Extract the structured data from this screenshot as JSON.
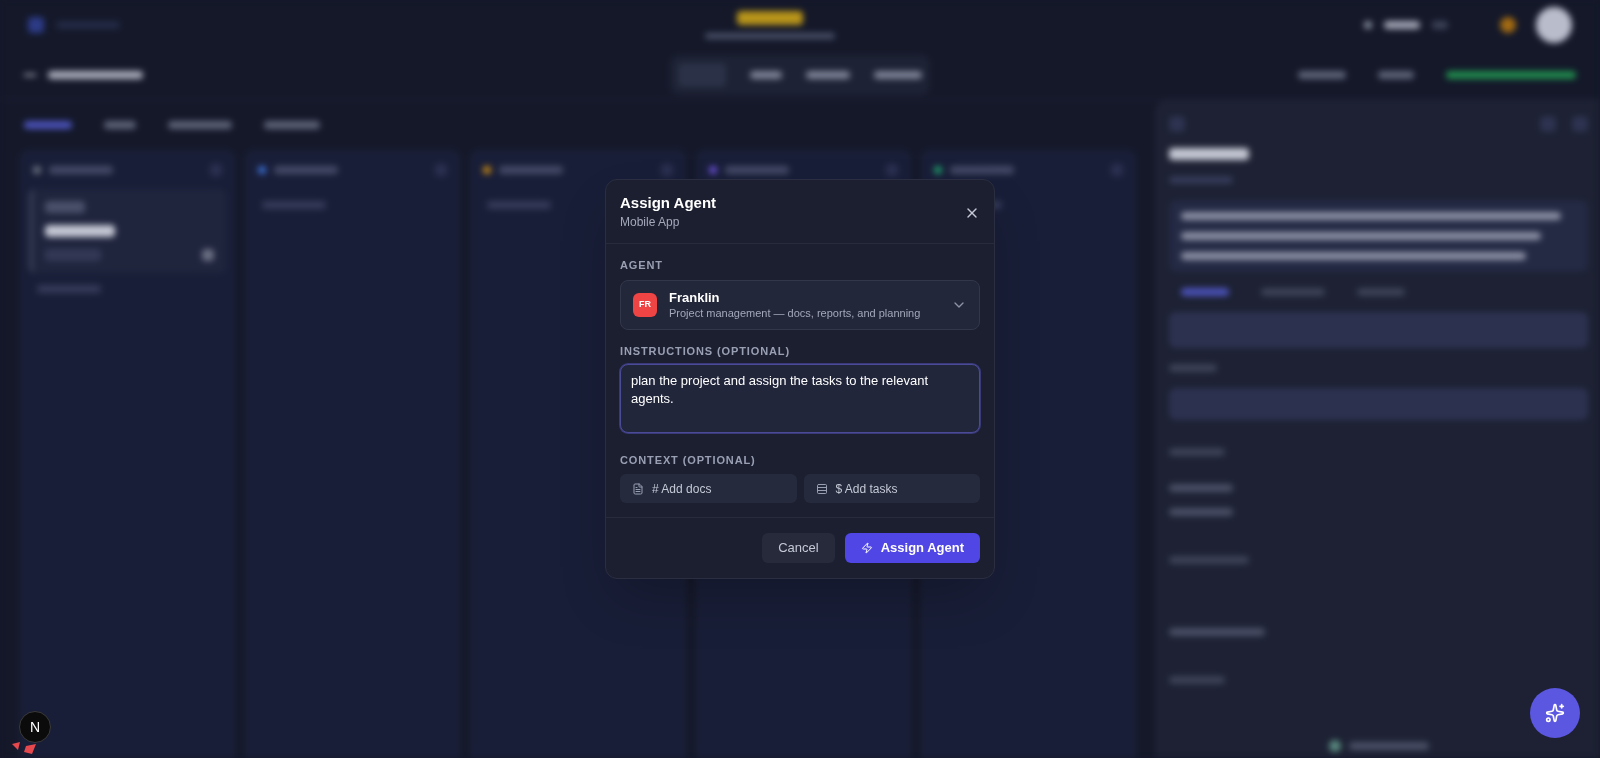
{
  "dialog": {
    "title": "Assign Agent",
    "subtitle": "Mobile App"
  },
  "agent": {
    "label": "AGENT",
    "selected": {
      "initials": "FR",
      "color": "#ef4444",
      "name": "Franklin",
      "description": "Project management — docs, reports, and planning"
    }
  },
  "instructions": {
    "label": "INSTRUCTIONS (OPTIONAL)",
    "value": "plan the project and assign the tasks to the relevant agents.",
    "focused": true
  },
  "context": {
    "label": "CONTEXT (OPTIONAL)",
    "buttons": [
      {
        "kind": "docs",
        "label": "# Add docs"
      },
      {
        "kind": "tasks",
        "label": "$ Add tasks"
      }
    ]
  },
  "footer": {
    "buttons": [
      {
        "kind": "secondary",
        "label": "Cancel"
      },
      {
        "kind": "primary",
        "label": "Assign Agent"
      }
    ]
  },
  "dev_badge": {
    "letter": "N"
  }
}
